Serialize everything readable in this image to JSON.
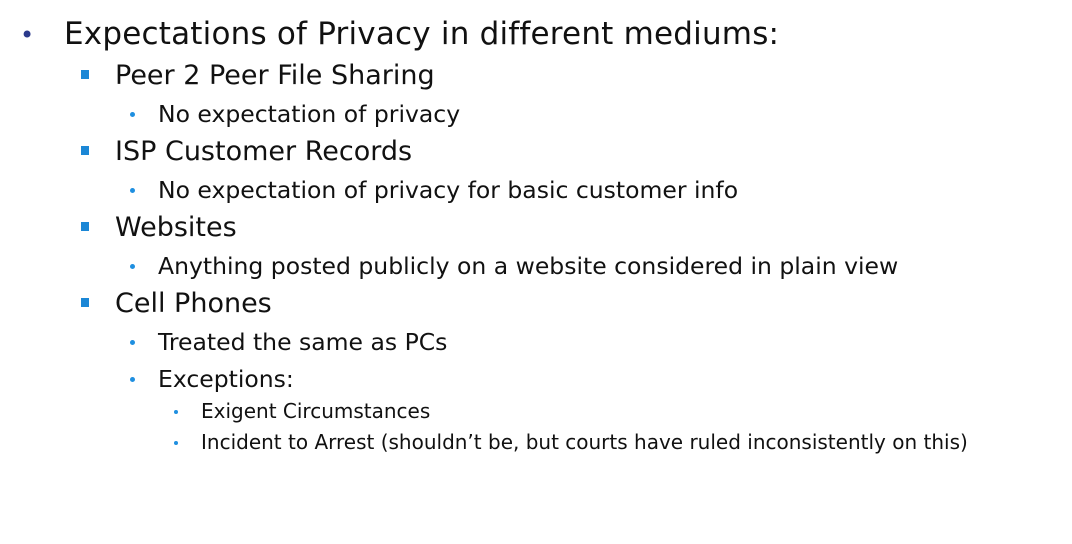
{
  "slide": {
    "heading": "Expectations of Privacy in different mediums:",
    "sections": [
      {
        "title": "Peer 2 Peer File Sharing",
        "points": [
          "No expectation of privacy"
        ]
      },
      {
        "title": "ISP Customer Records",
        "points": [
          "No expectation of privacy for basic customer info"
        ]
      },
      {
        "title": "Websites",
        "points": [
          "Anything posted publicly on a website considered in plain view"
        ]
      },
      {
        "title": "Cell Phones",
        "points": [
          "Treated the same as PCs",
          "Exceptions:"
        ],
        "exceptions": [
          "Exigent Circumstances",
          "Incident to Arrest (shouldn’t be, but courts have ruled inconsistently on this)"
        ]
      }
    ]
  }
}
